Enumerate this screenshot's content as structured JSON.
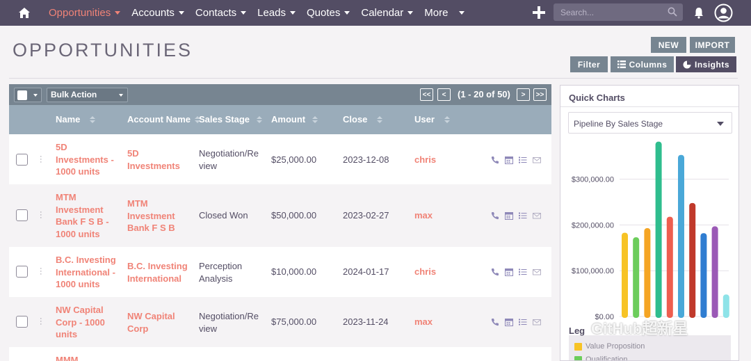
{
  "nav": {
    "items": [
      {
        "label": "Opportunities",
        "active": true
      },
      {
        "label": "Accounts"
      },
      {
        "label": "Contacts"
      },
      {
        "label": "Leads"
      },
      {
        "label": "Quotes"
      },
      {
        "label": "Calendar"
      },
      {
        "label": "More"
      }
    ],
    "search_placeholder": "Search..."
  },
  "page": {
    "title": "OPPORTUNITIES",
    "new_label": "NEW",
    "import_label": "IMPORT",
    "filter_label": "Filter",
    "columns_label": "Columns",
    "insights_label": "Insights"
  },
  "table": {
    "bulk_action": "Bulk Action",
    "pagination": {
      "first": "<<",
      "prev": "<",
      "info": "(1 - 20 of 50)",
      "next": ">",
      "last": ">>"
    },
    "headers": {
      "name": "Name",
      "account": "Account Name",
      "stage": "Sales Stage",
      "amount": "Amount",
      "close": "Close",
      "user": "User"
    },
    "rows": [
      {
        "name": "5D Investments - 1000 units",
        "account": "5D Investments",
        "stage": "Negotiation/Review",
        "amount": "$25,000.00",
        "close": "2023-12-08",
        "user": "chris"
      },
      {
        "name": "MTM Investment Bank F S B - 1000 units",
        "account": "MTM Investment Bank F S B",
        "stage": "Closed Won",
        "amount": "$50,000.00",
        "close": "2023-02-27",
        "user": "max"
      },
      {
        "name": "B.C. Investing International - 1000 units",
        "account": "B.C. Investing International",
        "stage": "Perception Analysis",
        "amount": "$10,000.00",
        "close": "2024-01-17",
        "user": "chris"
      },
      {
        "name": "NW Capital Corp - 1000 units",
        "account": "NW Capital Corp",
        "stage": "Negotiation/Review",
        "amount": "$75,000.00",
        "close": "2023-11-24",
        "user": "max"
      },
      {
        "name": "MMM"
      }
    ]
  },
  "quick_charts": {
    "title": "Quick Charts",
    "selected": "Pipeline By Sales Stage",
    "legend_title": "Leg",
    "legend": [
      {
        "name": "Value Proposition",
        "color": "#f7c325"
      },
      {
        "name": "Qualification",
        "color": "#6ccd5b"
      }
    ]
  },
  "chart_data": {
    "type": "bar",
    "ylim": [
      0,
      380000
    ],
    "yticks": [
      "$0.00",
      "$100,000.00",
      "$200,000.00",
      "$300,000.00"
    ],
    "ytick_values": [
      0,
      100000,
      200000,
      300000
    ],
    "grid": true,
    "values": [
      183000,
      173000,
      193000,
      382000,
      218000,
      353000,
      248000,
      182000,
      197000,
      48000
    ],
    "colors": [
      "#f7c325",
      "#6ccd5b",
      "#f5a524",
      "#2fbd8e",
      "#ee5e4f",
      "#4aa8d8",
      "#c0392b",
      "#2f7dd1",
      "#9b59b6",
      "#8ee3e8"
    ]
  },
  "watermark": "GitHub超新星"
}
